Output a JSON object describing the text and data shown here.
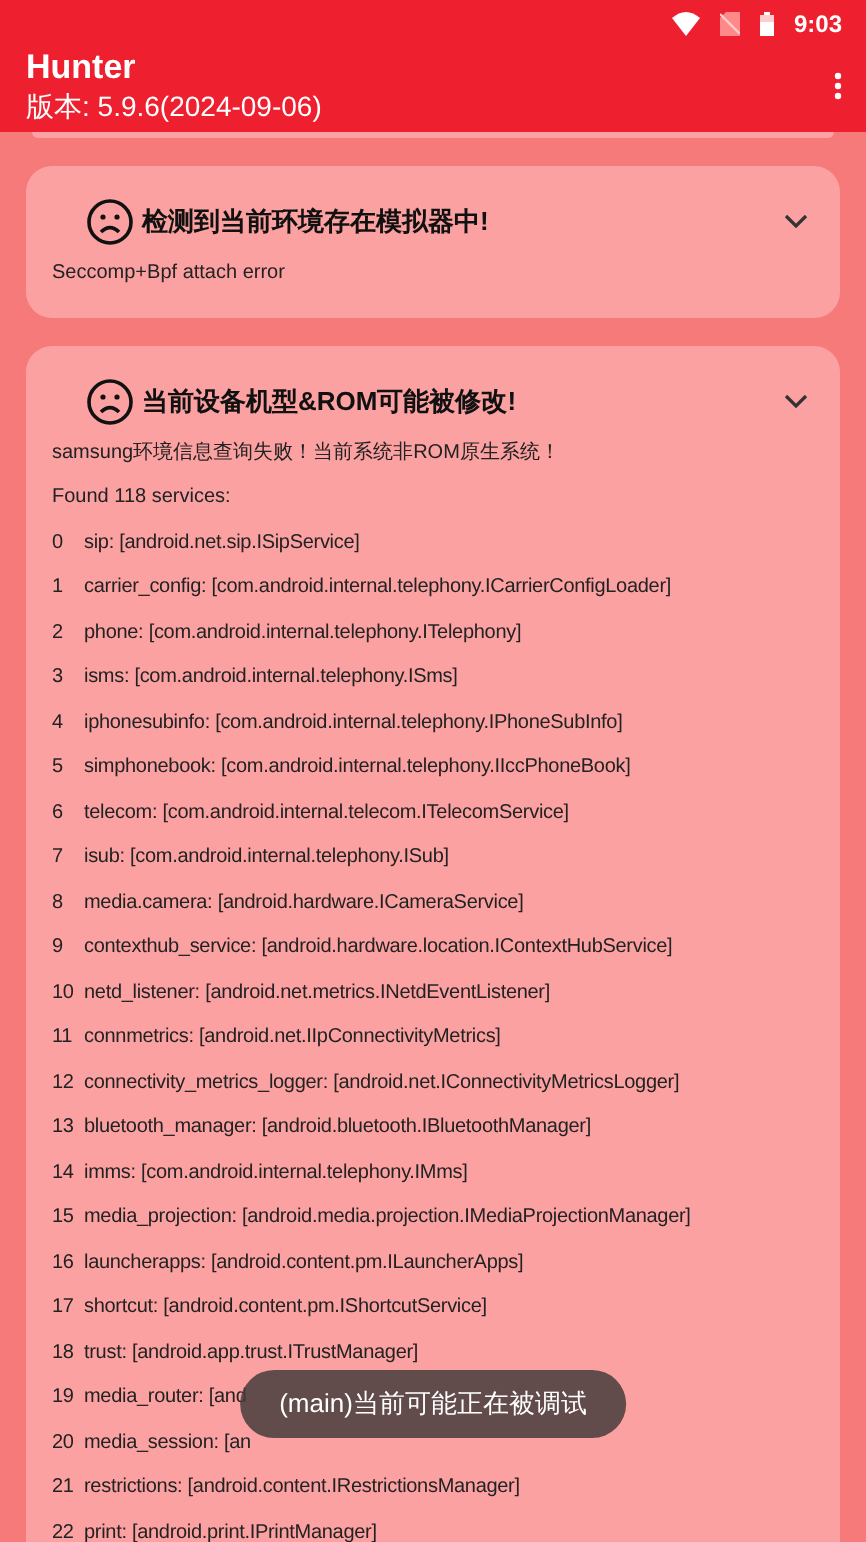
{
  "status_bar": {
    "time": "9:03"
  },
  "app_bar": {
    "title": "Hunter",
    "subtitle": "版本: 5.9.6(2024-09-06)"
  },
  "cards": [
    {
      "title": "检测到当前环境存在模拟器中!",
      "expanded": true,
      "lines": [
        "Seccomp+Bpf attach error"
      ]
    },
    {
      "title": "当前设备机型&ROM可能被修改!",
      "expanded": true,
      "lines": [
        "samsung环境信息查询失败！当前系统非ROM原生系统！",
        "Found 118 services:"
      ],
      "services": [
        {
          "index": "0",
          "text": "sip: [android.net.sip.ISipService]"
        },
        {
          "index": "1",
          "text": "carrier_config: [com.android.internal.telephony.ICarrierConfigLoader]"
        },
        {
          "index": "2",
          "text": "phone: [com.android.internal.telephony.ITelephony]"
        },
        {
          "index": "3",
          "text": "isms: [com.android.internal.telephony.ISms]"
        },
        {
          "index": "4",
          "text": "iphonesubinfo: [com.android.internal.telephony.IPhoneSubInfo]"
        },
        {
          "index": "5",
          "text": "simphonebook: [com.android.internal.telephony.IIccPhoneBook]"
        },
        {
          "index": "6",
          "text": "telecom: [com.android.internal.telecom.ITelecomService]"
        },
        {
          "index": "7",
          "text": "isub: [com.android.internal.telephony.ISub]"
        },
        {
          "index": "8",
          "text": "media.camera: [android.hardware.ICameraService]"
        },
        {
          "index": "9",
          "text": "contexthub_service: [android.hardware.location.IContextHubService]"
        },
        {
          "index": "10",
          "text": "netd_listener: [android.net.metrics.INetdEventListener]"
        },
        {
          "index": "11",
          "text": "connmetrics: [android.net.IIpConnectivityMetrics]"
        },
        {
          "index": "12",
          "text": "connectivity_metrics_logger: [android.net.IConnectivityMetricsLogger]"
        },
        {
          "index": "13",
          "text": "bluetooth_manager: [android.bluetooth.IBluetoothManager]"
        },
        {
          "index": "14",
          "text": "imms: [com.android.internal.telephony.IMms]"
        },
        {
          "index": "15",
          "text": "media_projection: [android.media.projection.IMediaProjectionManager]"
        },
        {
          "index": "16",
          "text": "launcherapps: [android.content.pm.ILauncherApps]"
        },
        {
          "index": "17",
          "text": "shortcut: [android.content.pm.IShortcutService]"
        },
        {
          "index": "18",
          "text": "trust: [android.app.trust.ITrustManager]"
        },
        {
          "index": "19",
          "text": "media_router: [and"
        },
        {
          "index": "20",
          "text": "media_session: [an"
        },
        {
          "index": "21",
          "text": "restrictions: [android.content.IRestrictionsManager]"
        },
        {
          "index": "22",
          "text": "print: [android.print.IPrintManager]"
        }
      ]
    }
  ],
  "toast": {
    "text": "(main)当前可能正在被调试"
  }
}
